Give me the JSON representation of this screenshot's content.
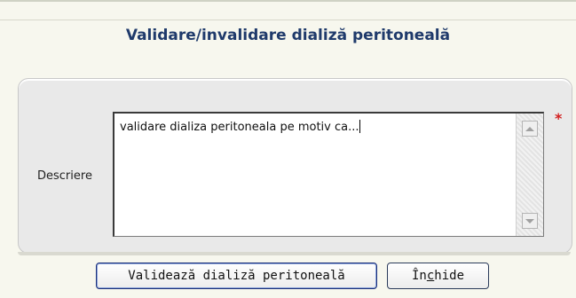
{
  "dialog": {
    "title": "Validare/invalidare dializă peritoneală"
  },
  "form": {
    "description_label": "Descriere",
    "description_value": "validare dializa peritoneala pe motiv ca...",
    "required_marker": "*"
  },
  "buttons": {
    "validate_label": "Validează dializă peritoneală",
    "close_label_pre": "În",
    "close_label_mnemonic": "c",
    "close_label_post": "hide"
  },
  "icons": {
    "scroll_up": "triangle-up",
    "scroll_down": "triangle-down"
  }
}
